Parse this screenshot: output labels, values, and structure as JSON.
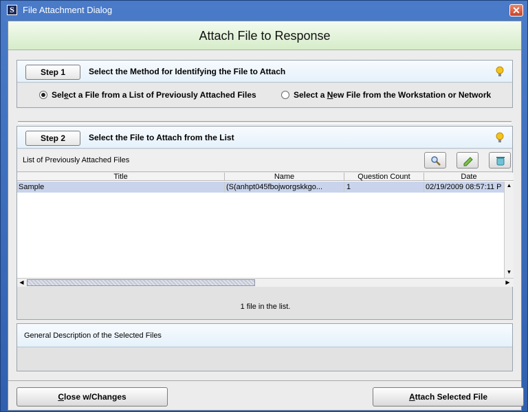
{
  "window": {
    "title": "File Attachment Dialog",
    "app_icon_letter": "S",
    "close_glyph": "✕"
  },
  "header": {
    "title": "Attach File to Response"
  },
  "step1": {
    "button_label": "Step 1",
    "instruction": "Select the Method for Identifying the File to Attach",
    "options": [
      {
        "label_pre": "Sel",
        "label_u": "e",
        "label_post": "ct a File from a List of Previously Attached Files",
        "selected": true
      },
      {
        "label_pre": "Select a ",
        "label_u": "N",
        "label_post": "ew File from the Workstation or Network",
        "selected": false
      }
    ]
  },
  "step2": {
    "button_label": "Step 2",
    "instruction": "Select the File to Attach from the List",
    "list_label": "List of Previously Attached Files",
    "toolbar": [
      "search-icon",
      "edit-pencil-icon",
      "delete-bin-icon"
    ],
    "columns": [
      "Title",
      "Name",
      "Question Count",
      "Date"
    ],
    "rows": [
      {
        "title": "Sample",
        "name": "(S(anhpt045fbojworgskkgo...",
        "question_count": "1",
        "date": "02/19/2009 08:57:11 P"
      }
    ],
    "file_count_text": "1 file in the list."
  },
  "description": {
    "label": "General Description of the Selected Files"
  },
  "footer": {
    "close_pre": "",
    "close_u": "C",
    "close_post": "lose w/Changes",
    "attach_pre": "",
    "attach_u": "A",
    "attach_post": "ttach Selected File"
  },
  "colors": {
    "header_green": "#d6ecc9",
    "selected_row": "#c9d4ec",
    "titlebar_blue": "#2f5fae"
  }
}
